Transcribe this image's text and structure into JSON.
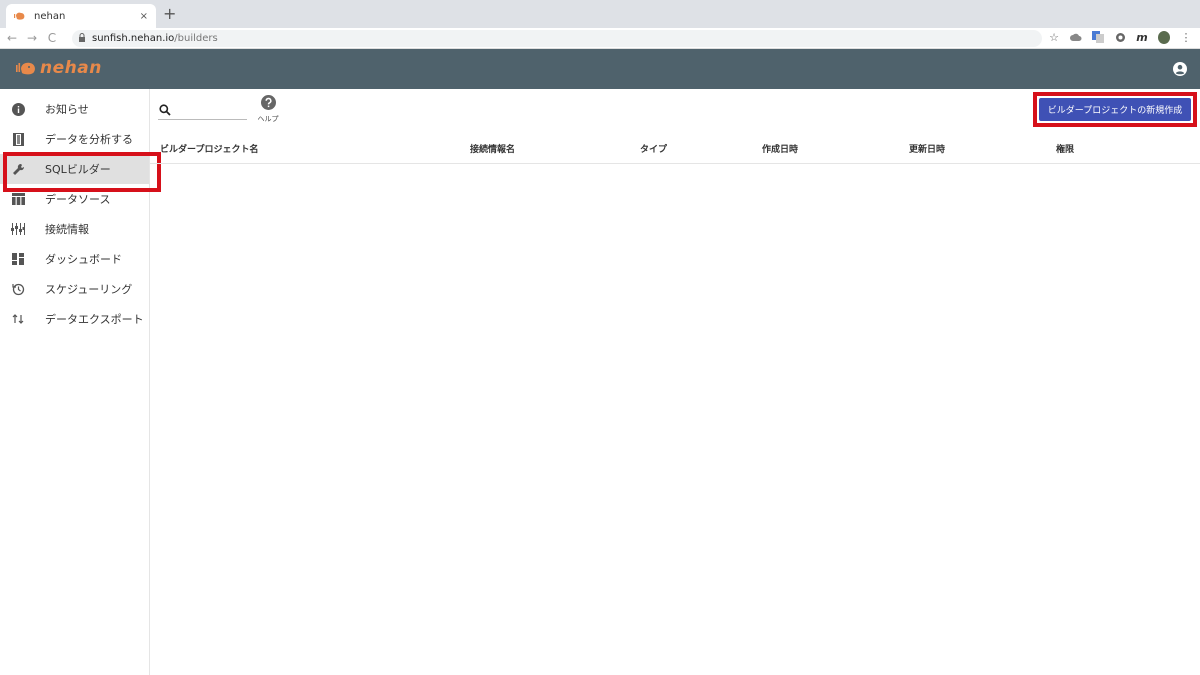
{
  "browser": {
    "tab_title": "nehan",
    "tab_close": "×",
    "new_tab": "+",
    "url_host": "sunfish.nehan.io",
    "url_path": "/builders",
    "nav_back": "←",
    "nav_forward": "→",
    "nav_reload": "C"
  },
  "header": {
    "logo_text": "nehan",
    "brand_color": "#e8894a",
    "bg_color": "#4f626c"
  },
  "sidebar": {
    "items": [
      {
        "label": "お知らせ",
        "icon": "info-icon"
      },
      {
        "label": "データを分析する",
        "icon": "film-icon"
      },
      {
        "label": "SQLビルダー",
        "icon": "wrench-icon",
        "active": true
      },
      {
        "label": "データソース",
        "icon": "table-icon"
      },
      {
        "label": "接続情報",
        "icon": "connection-icon"
      },
      {
        "label": "ダッシュボード",
        "icon": "dashboard-icon"
      },
      {
        "label": "スケジューリング",
        "icon": "schedule-icon"
      },
      {
        "label": "データエクスポート",
        "icon": "export-icon"
      }
    ]
  },
  "toolbar": {
    "search_placeholder": "",
    "help_label": "ヘルプ",
    "create_button": "ビルダープロジェクトの新規作成",
    "accent_color": "#3f51b5",
    "highlight_color": "#d6101a"
  },
  "table": {
    "columns": [
      "ビルダープロジェクト名",
      "接続情報名",
      "タイプ",
      "作成日時",
      "更新日時",
      "権限"
    ]
  }
}
